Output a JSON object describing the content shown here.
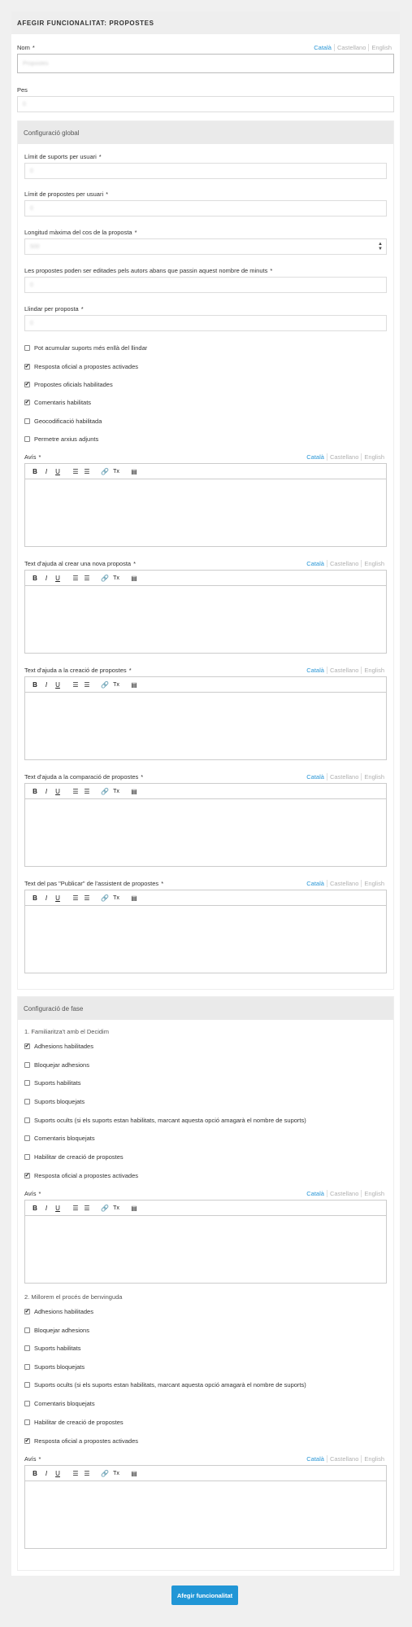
{
  "header": {
    "title": "AFEGIR FUNCIONALITAT: PROPOSTES"
  },
  "langs": [
    "Català",
    "Castellano",
    "English"
  ],
  "nom": {
    "label": "Nom",
    "value": "Propostes"
  },
  "pes": {
    "label": "Pes",
    "value": "0"
  },
  "global": {
    "title": "Configuració global",
    "limit_suports": {
      "label": "Límit de suports per usuari",
      "value": "0"
    },
    "limit_propostes": {
      "label": "Límit de propostes per usuari",
      "value": "0"
    },
    "longitud": {
      "label": "Longitud màxima del cos de la proposta",
      "value": "500"
    },
    "editar": {
      "label": "Les propostes poden ser editades pels autors abans que passin aquest nombre de minuts",
      "value": "0"
    },
    "llindar": {
      "label": "Llindar per proposta",
      "value": "0"
    },
    "checks": [
      {
        "label": "Pot acumular suports més enllà del llindar",
        "checked": false
      },
      {
        "label": "Resposta oficial a propostes activades",
        "checked": true
      },
      {
        "label": "Propostes oficials habilitades",
        "checked": true
      },
      {
        "label": "Comentaris habilitats",
        "checked": true
      },
      {
        "label": "Geocodificació habilitada",
        "checked": false
      },
      {
        "label": "Permetre arxius adjunts",
        "checked": false
      }
    ],
    "editors": [
      {
        "label": "Avís"
      },
      {
        "label": "Text d'ajuda al crear una nova proposta"
      },
      {
        "label": "Text d'ajuda a la creació de propostes"
      },
      {
        "label": "Text d'ajuda a la comparació de propostes"
      },
      {
        "label": "Text del pas \"Publicar\" de l'assistent de propostes"
      }
    ]
  },
  "fase": {
    "title": "Configuració de fase",
    "phases": [
      {
        "title": "1. Familiaritza't amb el Decidim",
        "checks": [
          {
            "label": "Adhesions habilitades",
            "checked": true
          },
          {
            "label": "Bloquejar adhesions",
            "checked": false
          },
          {
            "label": "Suports habilitats",
            "checked": false
          },
          {
            "label": "Suports bloquejats",
            "checked": false
          },
          {
            "label": "Suports ocults (si els suports estan habilitats, marcant aquesta opció amagarà el nombre de suports)",
            "checked": false
          },
          {
            "label": "Comentaris bloquejats",
            "checked": false
          },
          {
            "label": "Habilitar de creació de propostes",
            "checked": false
          },
          {
            "label": "Resposta oficial a propostes activades",
            "checked": true
          }
        ],
        "avis": "Avís"
      },
      {
        "title": "2. Millorem el procés de benvinguda",
        "checks": [
          {
            "label": "Adhesions habilitades",
            "checked": true
          },
          {
            "label": "Bloquejar adhesions",
            "checked": false
          },
          {
            "label": "Suports habilitats",
            "checked": false
          },
          {
            "label": "Suports bloquejats",
            "checked": false
          },
          {
            "label": "Suports ocults (si els suports estan habilitats, marcant aquesta opció amagarà el nombre de suports)",
            "checked": false
          },
          {
            "label": "Comentaris bloquejats",
            "checked": false
          },
          {
            "label": "Habilitar de creació de propostes",
            "checked": false
          },
          {
            "label": "Resposta oficial a propostes activades",
            "checked": true
          }
        ],
        "avis": "Avís"
      }
    ]
  },
  "toolbar": {
    "bold": "B",
    "italic": "I",
    "underline": "U",
    "ol": "☰",
    "ul": "☰",
    "link": "🔗",
    "clear": "Tx",
    "video": "▤"
  },
  "submit": {
    "label": "Afegir funcionalitat"
  },
  "required_mark": "*",
  "checkmark": "✔"
}
